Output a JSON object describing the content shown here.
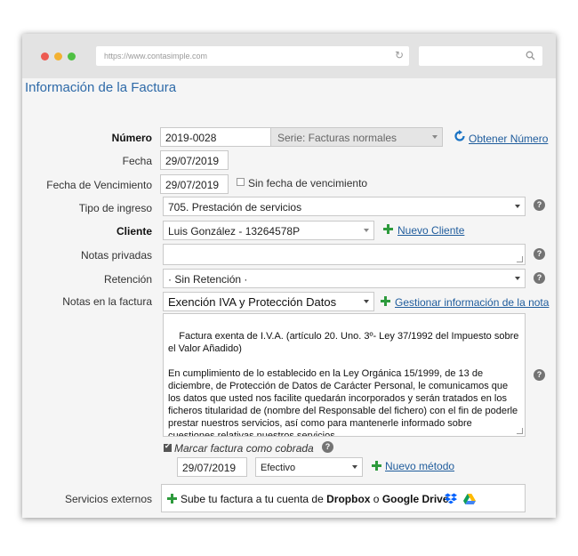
{
  "browser": {
    "url": "https://www.contasimple.com"
  },
  "page": {
    "title": "Información de la Factura"
  },
  "form": {
    "numero": {
      "label": "Número",
      "value": "2019-0028",
      "serie": "Serie: Facturas normales",
      "link": "Obtener Número"
    },
    "fecha": {
      "label": "Fecha",
      "value": "29/07/2019"
    },
    "vencimiento": {
      "label": "Fecha de Vencimiento",
      "value": "29/07/2019",
      "checkbox_label": "Sin fecha de vencimiento"
    },
    "tipo_ingreso": {
      "label": "Tipo de ingreso",
      "value": "705. Prestación de servicios"
    },
    "cliente": {
      "label": "Cliente",
      "value": "Luis González - 13264578P",
      "link": "Nuevo Cliente"
    },
    "notas_privadas": {
      "label": "Notas privadas",
      "value": ""
    },
    "retencion": {
      "label": "Retención",
      "value": "· Sin Retención ·"
    },
    "notas_factura": {
      "label": "Notas en la factura",
      "value": "Exención IVA y Protección Datos",
      "link": "Gestionar información de la nota",
      "text": "Factura exenta de I.V.A. (artículo 20. Uno. 3º- Ley 37/1992 del Impuesto sobre el Valor Añadido)\n\nEn cumplimiento de lo establecido en la Ley Orgánica 15/1999, de 13 de diciembre, de Protección de Datos de Carácter Personal, le comunicamos que los datos que usted nos facilite quedarán incorporados y serán tratados en los ficheros titularidad de (nombre del Responsable del fichero) con el fin de poderle prestar nuestros servicios, así como para mantenerle informado sobre cuestiones relativas nuestros servicios."
    },
    "cobrada": {
      "checkbox_label": "Marcar factura como cobrada",
      "date": "29/07/2019",
      "method": "Efectivo",
      "link": "Nuevo método"
    },
    "externos": {
      "label": "Servicios externos",
      "text_prefix": "Sube tu factura a tu cuenta de ",
      "dropbox": "Dropbox",
      "connector": " o ",
      "gdrive": "Google Drive"
    }
  },
  "help_glyph": "?",
  "colors": {
    "title": "#2e6aa8",
    "link": "#1f5c9c",
    "plus": "#2d9a3c",
    "dropbox": "#0061fe",
    "reload": "#1a73c4"
  }
}
